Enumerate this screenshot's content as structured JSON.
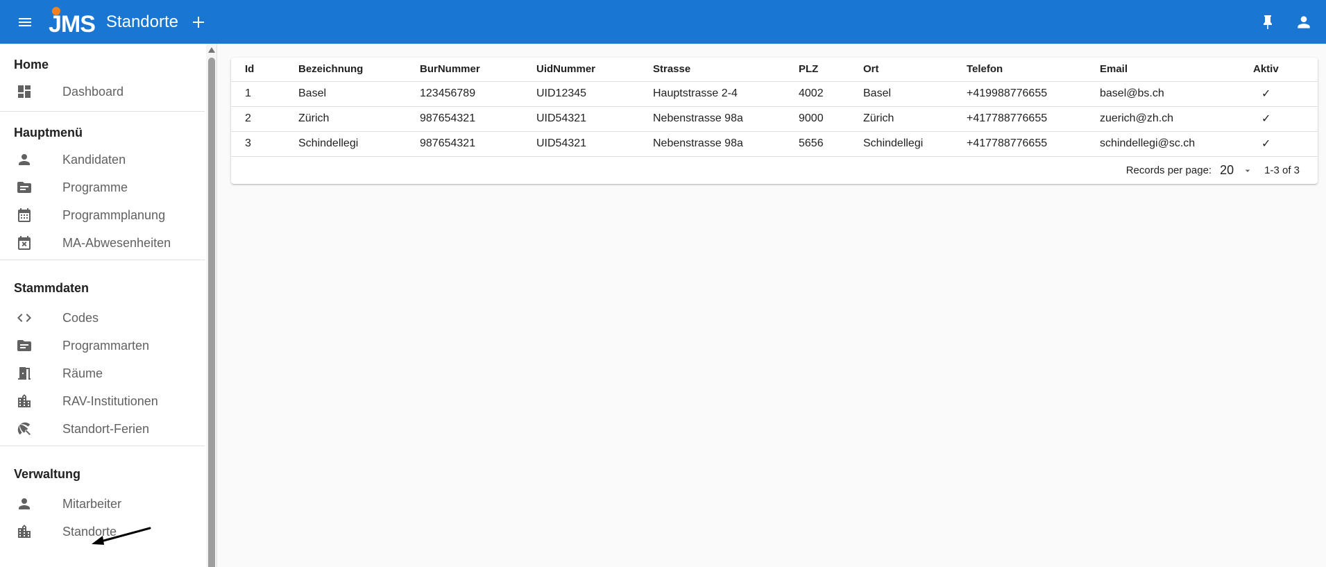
{
  "app": {
    "logo_text": "JMS",
    "page_title": "Standorte",
    "colors": {
      "appbar": "#1976d2",
      "logo_dot": "#f58220"
    }
  },
  "sidebar": {
    "sections": [
      {
        "title": "Home",
        "items": [
          {
            "label": "Dashboard",
            "icon": "dashboard-icon"
          }
        ]
      },
      {
        "title": "Hauptmenü",
        "items": [
          {
            "label": "Kandidaten",
            "icon": "person-icon"
          },
          {
            "label": "Programme",
            "icon": "folder-icon"
          },
          {
            "label": "Programmplanung",
            "icon": "calendar-icon"
          },
          {
            "label": "MA-Abwesenheiten",
            "icon": "calendar-remove-icon"
          }
        ]
      },
      {
        "title": "Stammdaten",
        "items": [
          {
            "label": "Codes",
            "icon": "code-icon"
          },
          {
            "label": "Programmarten",
            "icon": "folder-icon"
          },
          {
            "label": "Räume",
            "icon": "door-icon"
          },
          {
            "label": "RAV-Institutionen",
            "icon": "building-icon"
          },
          {
            "label": "Standort-Ferien",
            "icon": "umbrella-icon"
          }
        ]
      },
      {
        "title": "Verwaltung",
        "items": [
          {
            "label": "Mitarbeiter",
            "icon": "person-icon"
          },
          {
            "label": "Standorte",
            "icon": "building-icon"
          }
        ]
      }
    ]
  },
  "table": {
    "columns": [
      "Id",
      "Bezeichnung",
      "BurNummer",
      "UidNummer",
      "Strasse",
      "PLZ",
      "Ort",
      "Telefon",
      "Email",
      "Aktiv"
    ],
    "rows": [
      [
        "1",
        "Basel",
        "123456789",
        "UID12345",
        "Hauptstrasse 2-4",
        "4002",
        "Basel",
        "+419988776655",
        "basel@bs.ch",
        "✓"
      ],
      [
        "2",
        "Zürich",
        "987654321",
        "UID54321",
        "Nebenstrasse 98a",
        "9000",
        "Zürich",
        "+417788776655",
        "zuerich@zh.ch",
        "✓"
      ],
      [
        "3",
        "Schindellegi",
        "987654321",
        "UID54321",
        "Nebenstrasse 98a",
        "5656",
        "Schindellegi",
        "+417788776655",
        "schindellegi@sc.ch",
        "✓"
      ]
    ]
  },
  "pager": {
    "rpp_label": "Records per page:",
    "rpp_value": "20",
    "range": "1-3 of 3"
  }
}
